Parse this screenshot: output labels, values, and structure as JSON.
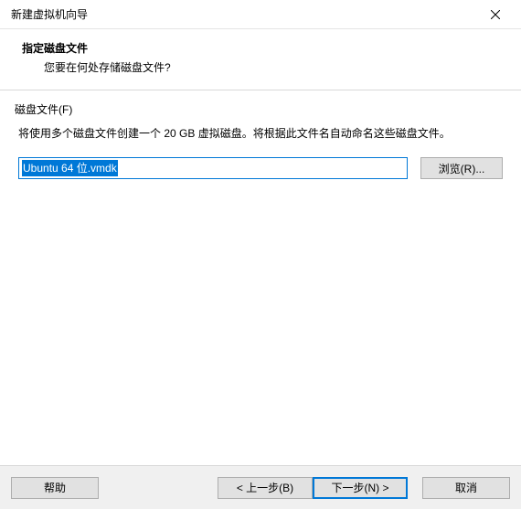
{
  "window": {
    "title": "新建虚拟机向导"
  },
  "header": {
    "title": "指定磁盘文件",
    "subtitle": "您要在何处存储磁盘文件?"
  },
  "section": {
    "label": "磁盘文件(F)",
    "description": "将使用多个磁盘文件创建一个 20 GB 虚拟磁盘。将根据此文件名自动命名这些磁盘文件。",
    "input_value": "Ubuntu 64 位.vmdk",
    "browse_label": "浏览(R)..."
  },
  "footer": {
    "help": "帮助",
    "back": "< 上一步(B)",
    "next": "下一步(N) >",
    "cancel": "取消"
  }
}
